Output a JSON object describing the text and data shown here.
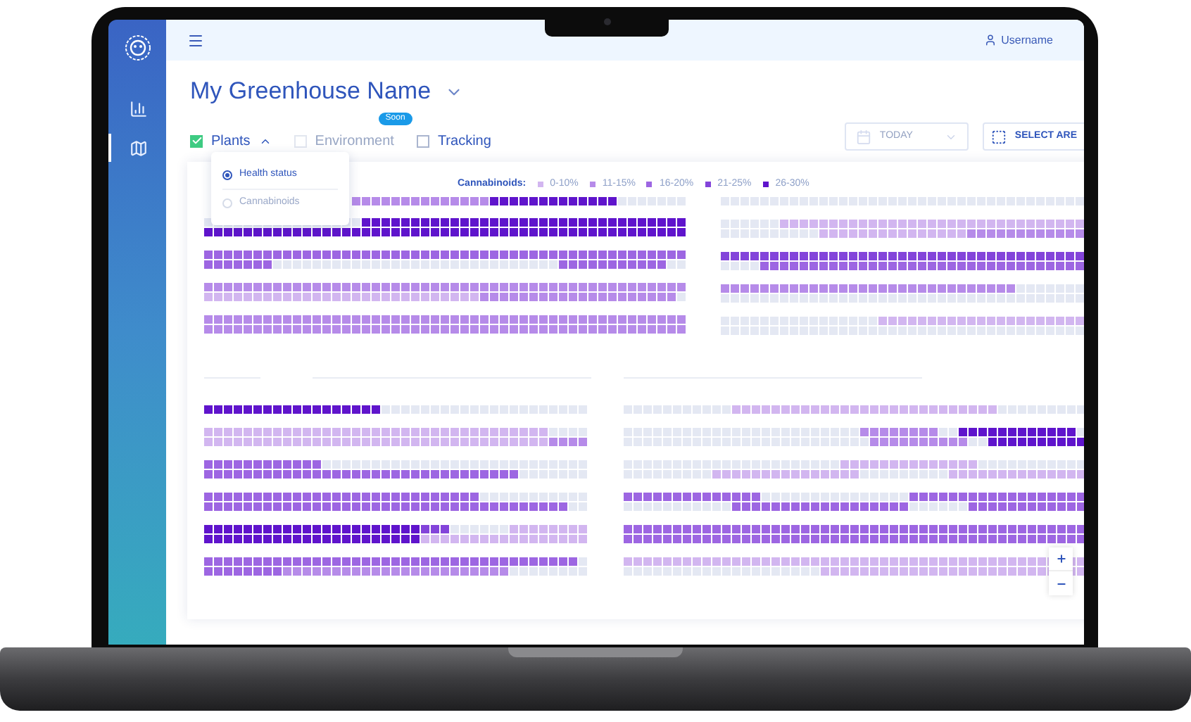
{
  "sidebar": {
    "items": [
      {
        "kind": "chart",
        "selected": false
      },
      {
        "kind": "map",
        "selected": true
      }
    ]
  },
  "topbar": {
    "user": "Username"
  },
  "title": "My Greenhouse Name",
  "layers": [
    {
      "label": "Plants",
      "checked": true,
      "disabled": false,
      "expanded": true
    },
    {
      "label": "Environment",
      "checked": false,
      "disabled": true,
      "badge": "Soon"
    },
    {
      "label": "Tracking",
      "checked": false,
      "disabled": false
    }
  ],
  "layer_menu": {
    "options": [
      {
        "label": "Health status",
        "selected": true
      },
      {
        "label": "Cannabinoids",
        "selected": false
      }
    ]
  },
  "date_picker": {
    "value": "TODAY"
  },
  "select_area_button": {
    "label": "SELECT ARE"
  },
  "legend": {
    "label": "Cannabinoids:",
    "items": [
      {
        "label": "0-10%",
        "color": "#d2b6f0"
      },
      {
        "label": "11-15%",
        "color": "#b68be9"
      },
      {
        "label": "16-20%",
        "color": "#9d66e2"
      },
      {
        "label": "21-25%",
        "color": "#8344da"
      },
      {
        "label": "26-30%",
        "color": "#5f14cc"
      }
    ]
  }
}
